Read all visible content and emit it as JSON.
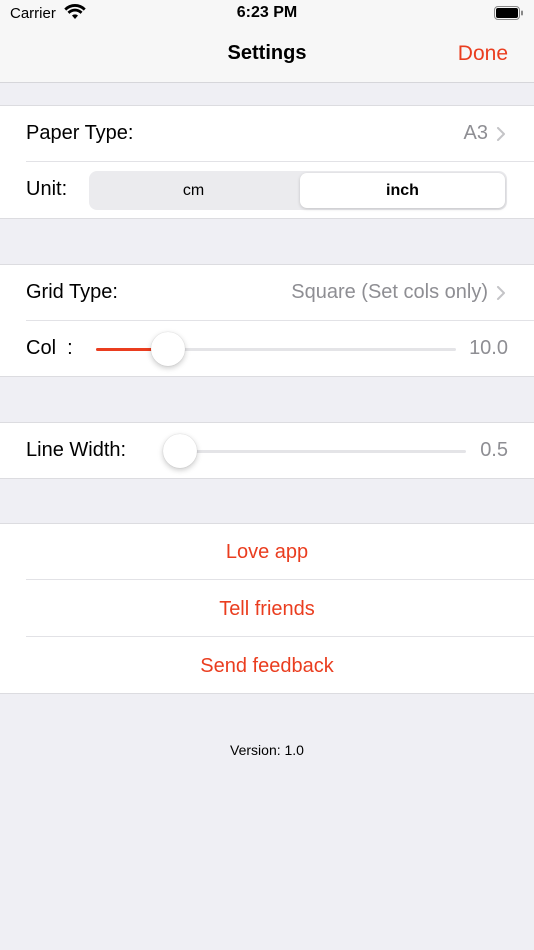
{
  "status_bar": {
    "carrier": "Carrier",
    "time": "6:23 PM"
  },
  "nav": {
    "title": "Settings",
    "done_label": "Done"
  },
  "paper": {
    "paper_type_label": "Paper Type:",
    "paper_type_value": "A3",
    "unit_label": "Unit:",
    "unit_options": [
      "cm",
      "inch"
    ],
    "unit_selected": "inch"
  },
  "grid": {
    "grid_type_label": "Grid Type:",
    "grid_type_value": "Square (Set cols only)",
    "col_label": "Col  :",
    "col_value": "10.0",
    "col_fraction": 0.2
  },
  "line": {
    "line_width_label": "Line Width:",
    "line_width_value": "0.5",
    "line_width_fraction": 0.0
  },
  "actions": {
    "love_app": "Love app",
    "tell_friends": "Tell friends",
    "send_feedback": "Send feedback"
  },
  "footer": {
    "version": "Version: 1.0"
  },
  "colors": {
    "accent": "#ea3d1f",
    "background": "#efeff4",
    "secondary_text": "#8e8e93"
  },
  "icons": {
    "wifi": "wifi-icon",
    "battery": "battery-icon",
    "chevron": "chevron-right-icon"
  }
}
